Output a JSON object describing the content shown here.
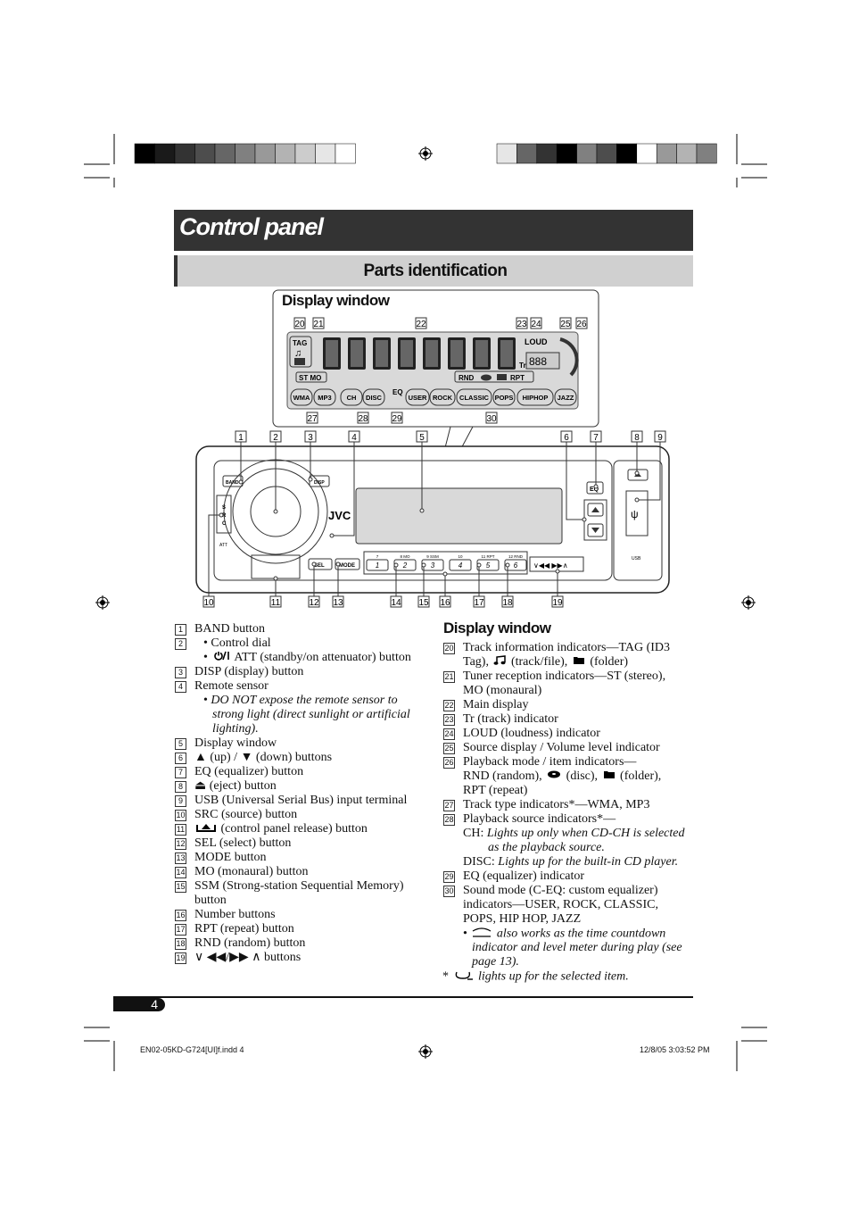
{
  "header": {
    "title": "Control panel",
    "subtitle": "Parts identification"
  },
  "display_window": {
    "title": "Display window",
    "callouts_top": [
      "20",
      "21",
      "22",
      "23",
      "24",
      "25",
      "26"
    ],
    "callouts_bottom": [
      "27",
      "28",
      "29",
      "30"
    ],
    "labels": {
      "tag": "TAG",
      "stmo": "ST MO",
      "loud": "LOUD",
      "tr": "Tr",
      "rnd": "RND",
      "rpt": "RPT",
      "eq": "EQ",
      "pills": [
        "WMA",
        "MP3",
        "CH",
        "DISC",
        "USER",
        "ROCK",
        "CLASSIC",
        "POPS",
        "HIPHOP",
        "JAZZ"
      ]
    }
  },
  "faceplate": {
    "callouts_top": [
      "1",
      "2",
      "3",
      "4",
      "5",
      "6",
      "7",
      "8",
      "9"
    ],
    "callouts_bottom": [
      "10",
      "11",
      "12",
      "13",
      "14",
      "15",
      "16",
      "17",
      "18",
      "19"
    ],
    "labels": {
      "band": "BAND",
      "disp": "DISP",
      "src": "SRC",
      "att": "ATT",
      "brand": "JVC",
      "eq": "EQ",
      "usb": "USB",
      "sel": "SEL",
      "mode": "MODE"
    },
    "number_buttons": [
      "1",
      "2",
      "3",
      "4",
      "5",
      "6"
    ],
    "number_tops": [
      "7",
      "8  MO",
      "9  SSM",
      "10",
      "11  RPT",
      "12  RND"
    ]
  },
  "left_list": [
    {
      "n": "1",
      "segs": [
        {
          "t": "BAND button"
        }
      ]
    },
    {
      "n": "2",
      "segs": [
        {
          "t": "• Control dial"
        }
      ],
      "ind": 10
    },
    {
      "segs": [
        {
          "t": "• "
        },
        {
          "icon": "power-icon"
        },
        {
          "t": "ATT (standby/on attenuator) button"
        }
      ],
      "ind": 10
    },
    {
      "n": "3",
      "segs": [
        {
          "t": "DISP (display) button"
        }
      ]
    },
    {
      "n": "4",
      "segs": [
        {
          "t": "Remote sensor"
        }
      ]
    },
    {
      "segs": [
        {
          "t": "• "
        },
        {
          "t": "DO NOT expose the remote sensor to",
          "i": true
        }
      ],
      "ind": 10
    },
    {
      "segs": [
        {
          "t": "strong light (direct sunlight or artificial",
          "i": true
        }
      ],
      "ind": 20
    },
    {
      "segs": [
        {
          "t": "lighting).",
          "i": true
        }
      ],
      "ind": 20
    },
    {
      "n": "5",
      "segs": [
        {
          "t": "Display window"
        }
      ]
    },
    {
      "n": "6",
      "segs": [
        {
          "t": "▲ (up) / ▼ (down) buttons"
        }
      ]
    },
    {
      "n": "7",
      "segs": [
        {
          "t": "EQ (equalizer) button"
        }
      ]
    },
    {
      "n": "8",
      "segs": [
        {
          "t": "⏏ (eject) button"
        }
      ]
    },
    {
      "n": "9",
      "segs": [
        {
          "t": "USB (Universal Serial Bus) input terminal"
        }
      ]
    },
    {
      "n": "10",
      "segs": [
        {
          "t": "SRC (source) button"
        }
      ]
    },
    {
      "n": "11",
      "segs": [
        {
          "icon": "panel-release-icon"
        },
        {
          "t": " (control panel release) button"
        }
      ]
    },
    {
      "n": "12",
      "segs": [
        {
          "t": "SEL (select) button"
        }
      ]
    },
    {
      "n": "13",
      "segs": [
        {
          "t": "MODE button"
        }
      ]
    },
    {
      "n": "14",
      "segs": [
        {
          "t": "MO (monaural) button"
        }
      ]
    },
    {
      "n": "15",
      "segs": [
        {
          "t": "SSM (Strong-station Sequential Memory)"
        }
      ]
    },
    {
      "segs": [
        {
          "t": "button"
        }
      ]
    },
    {
      "n": "16",
      "segs": [
        {
          "t": "Number buttons"
        }
      ]
    },
    {
      "n": "17",
      "segs": [
        {
          "t": "RPT (repeat) button"
        }
      ]
    },
    {
      "n": "18",
      "segs": [
        {
          "t": "RND (random) button"
        }
      ]
    },
    {
      "n": "19",
      "segs": [
        {
          "t": "∨ ◀◀/▶▶ ∧ buttons"
        }
      ]
    }
  ],
  "right_heading": "Display window",
  "right_list": [
    {
      "n": "20",
      "segs": [
        {
          "t": "Track information indicators—TAG (ID3"
        }
      ]
    },
    {
      "segs": [
        {
          "t": "Tag), "
        },
        {
          "icon": "music-note-icon"
        },
        {
          "t": " (track/file), "
        },
        {
          "icon": "folder-icon"
        },
        {
          "t": " (folder)"
        }
      ]
    },
    {
      "n": "21",
      "segs": [
        {
          "t": "Tuner reception indicators—ST (stereo),"
        }
      ]
    },
    {
      "segs": [
        {
          "t": "MO (monaural)"
        }
      ]
    },
    {
      "n": "22",
      "segs": [
        {
          "t": "Main display"
        }
      ]
    },
    {
      "n": "23",
      "segs": [
        {
          "t": "Tr (track) indicator"
        }
      ]
    },
    {
      "n": "24",
      "segs": [
        {
          "t": "LOUD (loudness) indicator"
        }
      ]
    },
    {
      "n": "25",
      "segs": [
        {
          "t": "Source display / Volume level indicator"
        }
      ]
    },
    {
      "n": "26",
      "segs": [
        {
          "t": "Playback mode / item indicators—"
        }
      ]
    },
    {
      "segs": [
        {
          "t": "RND (random), "
        },
        {
          "icon": "disc-icon"
        },
        {
          "t": " (disc), "
        },
        {
          "icon": "folder-icon"
        },
        {
          "t": " (folder),"
        }
      ]
    },
    {
      "segs": [
        {
          "t": "RPT (repeat)"
        }
      ]
    },
    {
      "n": "27",
      "segs": [
        {
          "t": "Track type indicators*—WMA, MP3"
        }
      ]
    },
    {
      "n": "28",
      "segs": [
        {
          "t": "Playback source indicators*—"
        }
      ]
    },
    {
      "segs": [
        {
          "t": "CH: "
        },
        {
          "t": "Lights up only when CD-CH is selected",
          "i": true
        }
      ]
    },
    {
      "segs": [
        {
          "t": "as the playback source.",
          "i": true
        }
      ],
      "ind": 28
    },
    {
      "segs": [
        {
          "t": "DISC: "
        },
        {
          "t": "Lights up for the built-in CD player.",
          "i": true
        }
      ]
    },
    {
      "n": "29",
      "segs": [
        {
          "t": "EQ (equalizer) indicator"
        }
      ]
    },
    {
      "n": "30",
      "segs": [
        {
          "t": "Sound mode (C-EQ: custom equalizer)"
        }
      ]
    },
    {
      "segs": [
        {
          "t": "indicators—USER, ROCK, CLASSIC,"
        }
      ]
    },
    {
      "segs": [
        {
          "t": "POPS, HIP HOP, JAZZ"
        }
      ]
    },
    {
      "segs": [
        {
          "t": "• "
        },
        {
          "icon": "arc-icon"
        },
        {
          "t": " also works as the time countdown",
          "i": true
        }
      ]
    },
    {
      "segs": [
        {
          "t": "indicator and level meter during play (see",
          "i": true
        }
      ],
      "ind": 10
    },
    {
      "segs": [
        {
          "t": "page 13).",
          "i": true
        }
      ],
      "ind": 10
    },
    {
      "segs": [
        {
          "t": "* "
        },
        {
          "icon": "highlight-loop-icon"
        },
        {
          "t": " lights up for the selected item.",
          "i": true
        }
      ],
      "ind": -23
    }
  ],
  "page_number": "4",
  "footer": {
    "file": "EN02-05KD-G724[UI]f.indd   4",
    "date": "12/8/05   3:03:52 PM"
  },
  "colors": {
    "band_dark": "#333333",
    "band_light": "#d0d0d0",
    "lcd": "#d9d9d9"
  }
}
